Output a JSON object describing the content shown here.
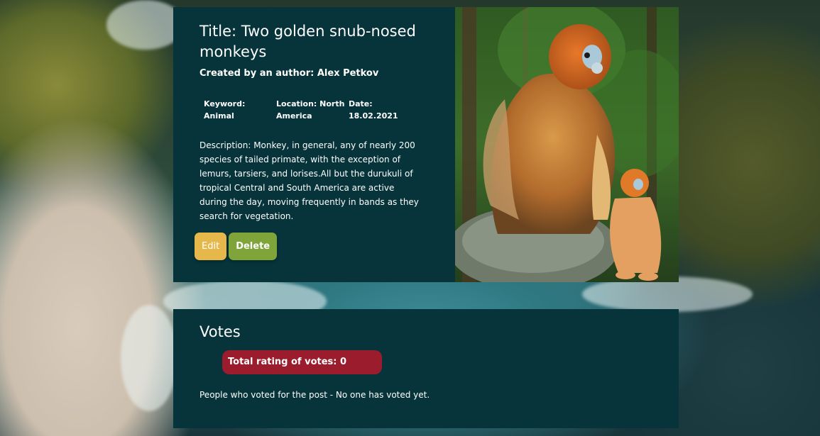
{
  "post": {
    "title": "Title: Two golden snub-nosed monkeys",
    "author": "Created by an author: Alex Petkov",
    "meta": [
      {
        "label": "Keyword:",
        "value": "Animal"
      },
      {
        "label": "Location: North",
        "value": "America"
      },
      {
        "label": "Date:",
        "value": "18.02.2021"
      }
    ],
    "description": "Description: Monkey, in general, any of nearly 200 species of tailed primate, with the exception of lemurs, tarsiers, and lorises.All but the durukuli of tropical Central and South America are active during the day, moving frequently in bands as they search for vegetation.",
    "image_alt": "Two golden snub-nosed monkeys",
    "edit_label": "Edit",
    "delete_label": "Delete"
  },
  "votes": {
    "title": "Votes",
    "rating_text": "Total rating of votes: 0",
    "voters_text": "People who voted for the post - No one has voted yet."
  },
  "colors": {
    "card": "#06343a",
    "edit": "#e6b84c",
    "delete": "#7ea43a",
    "rating": "#9b1c2c"
  }
}
